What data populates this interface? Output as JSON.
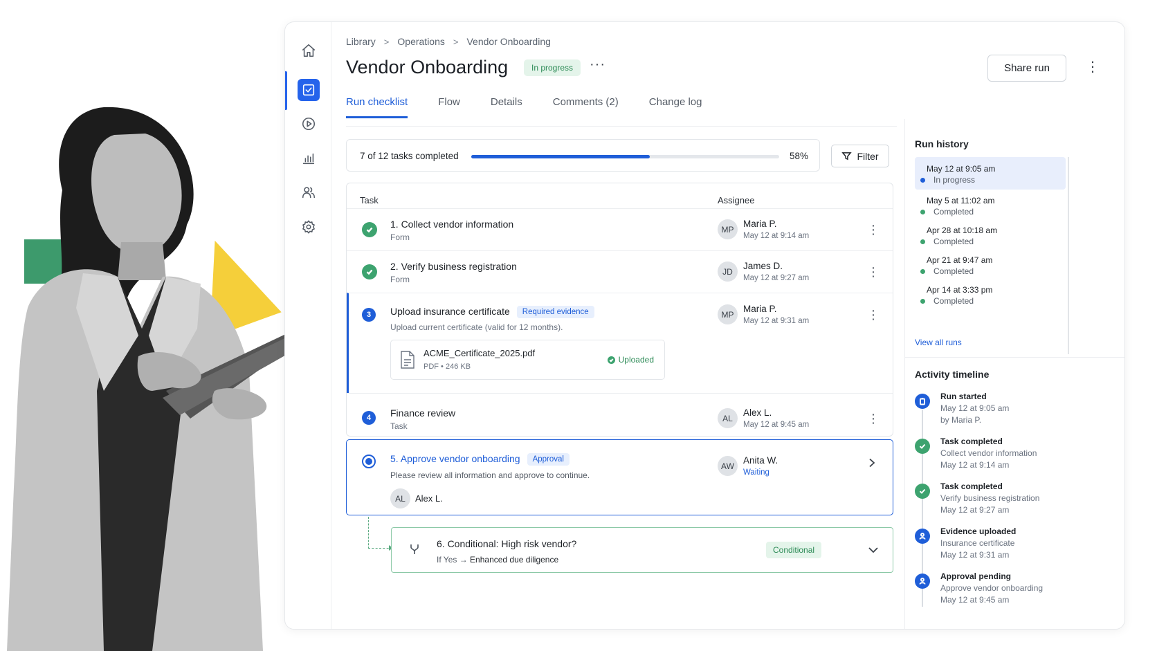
{
  "colors": {
    "accent": "#1f5ed8",
    "success": "#3da36f",
    "success_bg": "#e4f4ea"
  },
  "rail": [
    {
      "icon": "home-icon"
    },
    {
      "icon": "checklist-icon",
      "active": true
    },
    {
      "icon": "play-icon"
    },
    {
      "icon": "analytics-icon"
    },
    {
      "icon": "people-icon"
    },
    {
      "icon": "settings-icon"
    }
  ],
  "breadcrumb": {
    "items": [
      "Library",
      "Operations",
      "Vendor Onboarding"
    ],
    "separator": ">"
  },
  "header": {
    "title": "Vendor Onboarding",
    "status": "In progress",
    "more": "···",
    "share_label": "Share run",
    "kebab": "⋮"
  },
  "tabs": [
    {
      "label": "Run checklist",
      "active": true
    },
    {
      "label": "Flow"
    },
    {
      "label": "Details"
    },
    {
      "label": "Comments (2)"
    },
    {
      "label": "Change log"
    }
  ],
  "progress": {
    "text": "7 of 12 tasks completed",
    "value": 0.58,
    "pct_label": "58%"
  },
  "filter_label": "Filter",
  "table": {
    "headers": {
      "task": "Task",
      "assignee": "Assignee"
    },
    "tasks": [
      {
        "name": "1. Collect vendor information",
        "type": "Form",
        "initials": "MP",
        "assignee": "Maria P.",
        "time": "May 12 at 9:14 am",
        "state": "done"
      },
      {
        "name": "2. Verify business registration",
        "type": "Form",
        "initials": "JD",
        "assignee": "James D.",
        "time": "May 12 at 9:27 am",
        "state": "done"
      },
      {
        "number": "3",
        "name": "Upload insurance certificate",
        "tag": "Required evidence",
        "desc": "Upload current certificate (valid for 12 months).",
        "initials": "MP",
        "assignee": "Maria P.",
        "time": "May 12 at 9:31 am",
        "state": "current",
        "file": {
          "name": "ACME_Certificate_2025.pdf",
          "meta": "PDF • 246 KB",
          "status": "Uploaded"
        }
      },
      {
        "number": "4",
        "name": "Finance review",
        "type": "Task",
        "initials": "AL",
        "assignee": "Alex L.",
        "time": "May 12 at 9:45 am",
        "state": "todo"
      }
    ]
  },
  "approval": {
    "title": "5. Approve vendor onboarding",
    "tag": "Approval",
    "desc": "Please review all information and approve to continue.",
    "reviewer_initials": "AL",
    "reviewer": "Alex L.",
    "initials": "AW",
    "assignee": "Anita W.",
    "status": "Waiting"
  },
  "conditional": {
    "title": "6. Conditional: High risk vendor?",
    "prefix": "If Yes →",
    "target": "Enhanced due diligence",
    "tag": "Conditional"
  },
  "run_history": {
    "title": "Run history",
    "runs": [
      {
        "date": "May 12 at 9:05 am",
        "status": "In progress",
        "dot": "#1f5ed8",
        "active": true
      },
      {
        "date": "May 5 at 11:02 am",
        "status": "Completed",
        "dot": "#3da36f"
      },
      {
        "date": "Apr 28 at 10:18 am",
        "status": "Completed",
        "dot": "#3da36f"
      },
      {
        "date": "Apr 21 at 9:47 am",
        "status": "Completed",
        "dot": "#3da36f"
      },
      {
        "date": "Apr 14 at 3:33 pm",
        "status": "Completed",
        "dot": "#3da36f"
      }
    ],
    "view_all": "View all runs"
  },
  "activity": {
    "title": "Activity timeline",
    "items": [
      {
        "title": "Run started",
        "line1": "May 12 at 9:05 am",
        "line2": "by Maria P.",
        "color": "#1f5ed8",
        "icon": "clipboard-icon"
      },
      {
        "title": "Task completed",
        "line1": "Collect vendor information",
        "line2": "May 12 at 9:14 am",
        "color": "#3da36f",
        "icon": "check-icon"
      },
      {
        "title": "Task completed",
        "line1": "Verify business registration",
        "line2": "May 12 at 9:27 am",
        "color": "#3da36f",
        "icon": "check-icon"
      },
      {
        "title": "Evidence uploaded",
        "line1": "Insurance certificate",
        "line2": "May 12 at 9:31 am",
        "color": "#1f5ed8",
        "icon": "person-icon"
      },
      {
        "title": "Approval pending",
        "line1": "Approve vendor onboarding",
        "line2": "May 12 at 9:45 am",
        "color": "#1f5ed8",
        "icon": "person-icon"
      }
    ]
  }
}
